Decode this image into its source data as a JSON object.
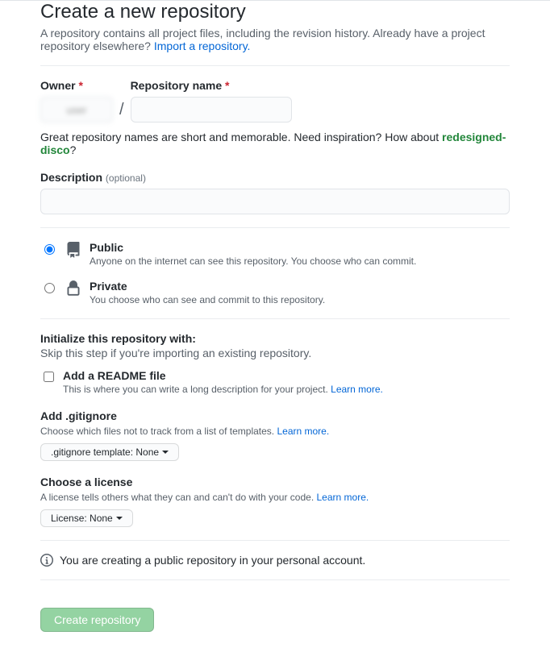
{
  "header": {
    "title": "Create a new repository",
    "subtitle_pre": "A repository contains all project files, including the revision history. Already have a project repository elsewhere? ",
    "import_link": "Import a repository."
  },
  "owner": {
    "label": "Owner",
    "chip_placeholder": "user"
  },
  "repo": {
    "label": "Repository name"
  },
  "name_helper": {
    "pre": "Great repository names are short and memorable. Need inspiration? How about ",
    "suggestion": "redesigned-disco",
    "post": "?"
  },
  "description": {
    "label": "Description",
    "optional": "(optional)"
  },
  "visibility": {
    "public": {
      "label": "Public",
      "desc": "Anyone on the internet can see this repository. You choose who can commit."
    },
    "private": {
      "label": "Private",
      "desc": "You choose who can see and commit to this repository."
    }
  },
  "init": {
    "heading": "Initialize this repository with:",
    "skip": "Skip this step if you're importing an existing repository."
  },
  "readme": {
    "label": "Add a README file",
    "desc": "This is where you can write a long description for your project. ",
    "learn": "Learn more."
  },
  "gitignore": {
    "heading": "Add .gitignore",
    "desc": "Choose which files not to track from a list of templates. ",
    "learn": "Learn more.",
    "button": ".gitignore template: None"
  },
  "license": {
    "heading": "Choose a license",
    "desc": "A license tells others what they can and can't do with your code. ",
    "learn": "Learn more.",
    "button": "License: None"
  },
  "info": "You are creating a public repository in your personal account.",
  "submit": "Create repository"
}
